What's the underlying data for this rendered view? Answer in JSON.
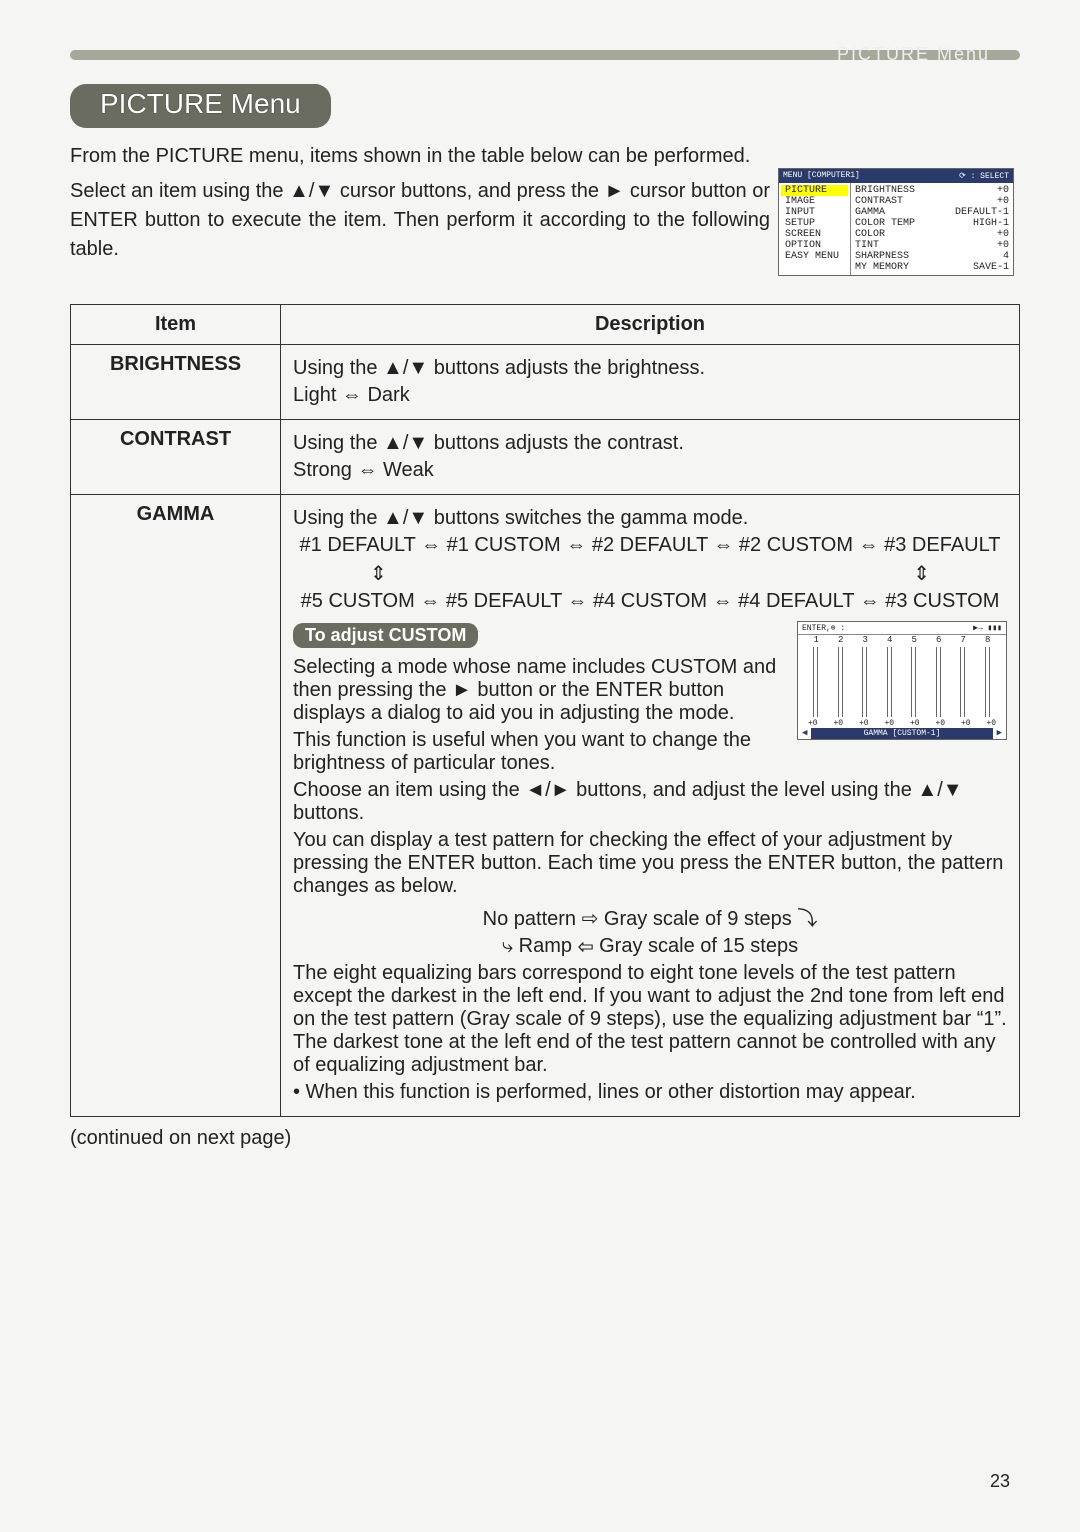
{
  "header": {
    "breadcrumb": "PICTURE Menu",
    "title": "PICTURE Menu"
  },
  "intro": {
    "p1": "From the PICTURE menu, items shown in the table below can be performed.",
    "p2": "Select an item using the ▲/▼ cursor buttons, and press the ► cursor button or ENTER button to execute the item. Then perform it according to the following table."
  },
  "osd": {
    "title_left": "MENU [COMPUTER1]",
    "title_right": "⟳ : SELECT",
    "left_items": [
      "PICTURE",
      "IMAGE",
      "INPUT",
      "SETUP",
      "SCREEN",
      "OPTION",
      "EASY MENU"
    ],
    "selected_index": 0,
    "right_labels": [
      "BRIGHTNESS",
      "CONTRAST",
      "GAMMA",
      "COLOR TEMP",
      "COLOR",
      "TINT",
      "SHARPNESS",
      "MY MEMORY"
    ],
    "right_values": [
      "+0",
      "+0",
      "DEFAULT-1",
      "HIGH-1",
      "+0",
      "+0",
      "4",
      "SAVE-1"
    ]
  },
  "table": {
    "head_item": "Item",
    "head_desc": "Description",
    "rows": [
      {
        "item": "BRIGHTNESS",
        "desc_lines": [
          "Using the ▲/▼ buttons adjusts the brightness.",
          "Light ⇔ Dark"
        ]
      },
      {
        "item": "CONTRAST",
        "desc_lines": [
          "Using the ▲/▼ buttons adjusts the contrast.",
          "Strong ⇔ Weak"
        ]
      },
      {
        "item": "GAMMA",
        "part1": "Using the ▲/▼ buttons switches the gamma mode.",
        "seq1": "#1 DEFAULT ⇔ #1 CUSTOM ⇔ #2 DEFAULT ⇔ #2 CUSTOM ⇔ #3 DEFAULT",
        "seq2": "#5 CUSTOM ⇔ #5 DEFAULT ⇔ #4 CUSTOM ⇔ #4 DEFAULT ⇔ #3 CUSTOM",
        "subheading": "To adjust CUSTOM",
        "custom_p1": "Selecting a mode whose name includes CUSTOM and then pressing the ► button or the ENTER button displays a dialog to aid you in adjusting the mode.",
        "custom_p2": "This function is useful when you want to change the brightness of particular tones.",
        "custom_p3": "Choose an item using the ◄/► buttons, and adjust the level using the ▲/▼ buttons.",
        "custom_p4": "You can display a test pattern for checking the effect of your adjustment by pressing the ENTER button. Each time you press the ENTER button, the pattern changes as below.",
        "pattern1": "No pattern ⇨ Gray scale of 9 steps ⤵",
        "pattern2": "⤷ Ramp ⇦ Gray scale of 15 steps",
        "custom_p5": "The eight equalizing bars correspond to eight tone levels of the test pattern except the darkest in the left end. If you want to adjust the 2nd tone from left end on the test pattern (Gray scale of 9 steps), use the equalizing adjustment bar “1”. The darkest tone at the left end of the test pattern cannot be controlled with any of equalizing adjustment bar.",
        "custom_p6": "• When this function is performed, lines or other distortion may appear."
      }
    ]
  },
  "gamma_dialog": {
    "hdr_left": "ENTER,⊕ :",
    "hdr_right": "▶→ ▮▮▮",
    "numbers": [
      "1",
      "2",
      "3",
      "4",
      "5",
      "6",
      "7",
      "8"
    ],
    "values": [
      "+0",
      "+0",
      "+0",
      "+0",
      "+0",
      "+0",
      "+0",
      "+0"
    ],
    "footer": "GAMMA [CUSTOM-1]",
    "footer_arrows_left": "◀",
    "footer_arrows_right": "▶"
  },
  "continued": "(continued on next page)",
  "page_number": "23"
}
